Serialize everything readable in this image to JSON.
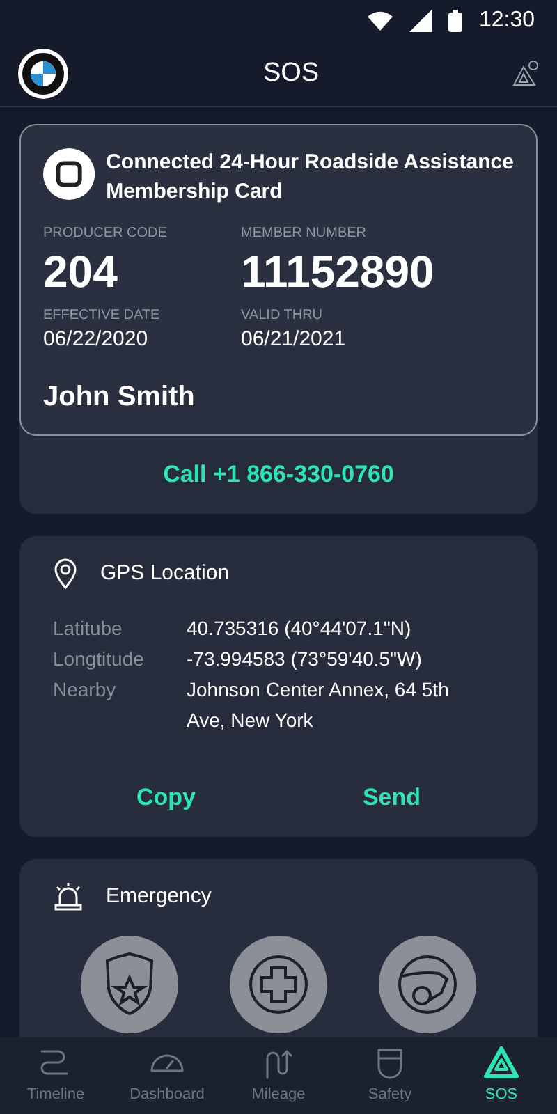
{
  "status_bar": {
    "time": "12:30"
  },
  "header": {
    "title": "SOS"
  },
  "membership_card": {
    "title": "Connected 24-Hour Roadside Assistance Membership Card",
    "fields": [
      {
        "label": "PRODUCER CODE",
        "value": "204",
        "kind": "big"
      },
      {
        "label": "MEMBER NUMBER",
        "value": "11152890",
        "kind": "big"
      },
      {
        "label": "EFFECTIVE DATE",
        "value": "06/22/2020",
        "kind": "small"
      },
      {
        "label": "VALID THRU",
        "value": "06/21/2021",
        "kind": "small"
      }
    ],
    "holder": "John Smith",
    "call_button": "Call +1 866-330-0760"
  },
  "gps": {
    "title": "GPS Location",
    "rows": [
      {
        "label": "Latitube",
        "value": "40.735316 (40°44'07.1\"N)"
      },
      {
        "label": "Longtitude",
        "value": "-73.994583 (73°59'40.5\"W)"
      },
      {
        "label": "Nearby",
        "value": "Johnson Center Annex, 64 5th Ave, New York"
      }
    ],
    "actions": [
      "Copy",
      "Send"
    ]
  },
  "emergency": {
    "title": "Emergency",
    "services": [
      {
        "kind": "police"
      },
      {
        "kind": "medical"
      },
      {
        "kind": "crash"
      }
    ]
  },
  "bottom_nav": [
    {
      "label": "Timeline",
      "kind": "timeline",
      "selected": false
    },
    {
      "label": "Dashboard",
      "kind": "dashboard",
      "selected": false
    },
    {
      "label": "Mileage",
      "kind": "mileage",
      "selected": false
    },
    {
      "label": "Safety",
      "kind": "safety",
      "selected": false
    },
    {
      "label": "SOS",
      "kind": "sos",
      "selected": true
    }
  ]
}
